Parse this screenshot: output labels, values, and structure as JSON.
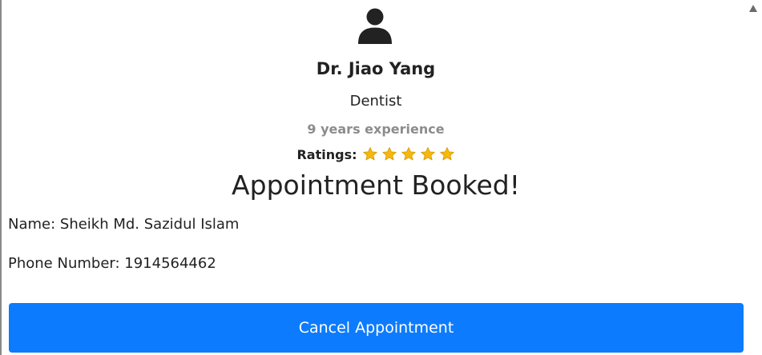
{
  "doctor": {
    "icon": "user-icon",
    "name": "Dr. Jiao Yang",
    "specialty": "Dentist",
    "experience": "9 years experience",
    "ratings_label": "Ratings:",
    "rating": 5,
    "rating_max": 5,
    "star_icon": "star-icon",
    "star_color": "#F5B80F"
  },
  "status": {
    "message": "Appointment Booked!"
  },
  "patient": {
    "name_line": "Name: Sheikh Md. Sazidul Islam",
    "phone_line": "Phone Number: 1914564462"
  },
  "actions": {
    "cancel_label": "Cancel Appointment",
    "cancel_color": "#0D7BFD"
  },
  "scrollbar": {
    "up_icon": "scroll-up-arrow-icon"
  }
}
